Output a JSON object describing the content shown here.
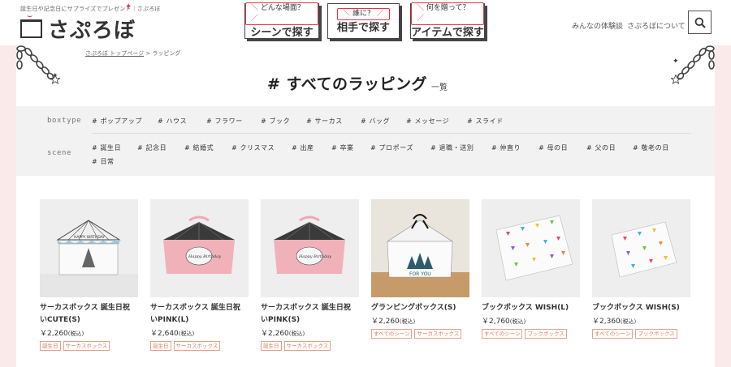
{
  "header": {
    "tagline": "誕生日や記念日にサプライズでプレゼント｜さぷろぼ",
    "logo_text": "さぷろぼ",
    "nav": [
      {
        "sub": "どんな場面？",
        "main": "シーンで探す"
      },
      {
        "sub": "誰に？",
        "main": "相手で探す"
      },
      {
        "sub": "何を贈って？",
        "main": "アイテムで探す"
      }
    ],
    "links": [
      "みんなの体験談",
      "さぷろぼについて"
    ]
  },
  "breadcrumb": {
    "home": "さぷろぼ トップページ",
    "sep": ">",
    "current": "ラッピング"
  },
  "page": {
    "title": "# すべてのラッピング",
    "suffix": "一覧"
  },
  "filters": {
    "boxtype": {
      "label": "boxtype",
      "tags": [
        "# ポップアップ",
        "# ハウス",
        "# フラワー",
        "# ブック",
        "# サーカス",
        "# バッグ",
        "# メッセージ",
        "# スライド"
      ]
    },
    "scene": {
      "label": "scene",
      "tags": [
        "# 誕生日",
        "# 記念日",
        "# 結婚式",
        "# クリスマス",
        "# 出産",
        "# 卒業",
        "# プロポーズ",
        "# 退職・送別",
        "# 仲直り",
        "# 母の日",
        "# 父の日",
        "# 敬老の日",
        "# 日常"
      ]
    }
  },
  "products": [
    {
      "name1": "サーカスボックス 誕生日祝",
      "name2": "いCUTE(S)",
      "price": "￥2,260",
      "tax": "(税込)",
      "tags": [
        "誕生日",
        "サーカスボックス"
      ],
      "image": "circus-cute-photo"
    },
    {
      "name1": "サーカスボックス 誕生日祝",
      "name2": "いPINK(L)",
      "price": "￥2,640",
      "tax": "(税込)",
      "tags": [
        "誕生日",
        "サーカスボックス"
      ],
      "image": "circus-pink-large-photo"
    },
    {
      "name1": "サーカスボックス 誕生日祝",
      "name2": "いPINK(S)",
      "price": "￥2,260",
      "tax": "(税込)",
      "tags": [
        "誕生日",
        "サーカスボックス"
      ],
      "image": "circus-pink-small-photo"
    },
    {
      "name1": "グランピングボックス(S)",
      "name2": "",
      "price": "￥2,260",
      "tax": "(税込)",
      "tags": [
        "すべてのシーン",
        "サーカスボックス"
      ],
      "image": "glamping-box-photo"
    },
    {
      "name1": "ブックボックス WISH(L)",
      "name2": "",
      "price": "￥2,760",
      "tax": "(税込)",
      "tags": [
        "すべてのシーン",
        "ブックボックス"
      ],
      "image": "book-wish-large-photo"
    },
    {
      "name1": "ブックボックス WISH(S)",
      "name2": "",
      "price": "￥2,360",
      "tax": "(税込)",
      "tags": [
        "すべてのシーン",
        "ブックボックス"
      ],
      "image": "book-wish-small-photo"
    }
  ],
  "colors": {
    "accent": "#e3343f",
    "highlight": "#f4e34c",
    "tag_border": "#e9a08c",
    "page_bg": "#fbeaea"
  }
}
